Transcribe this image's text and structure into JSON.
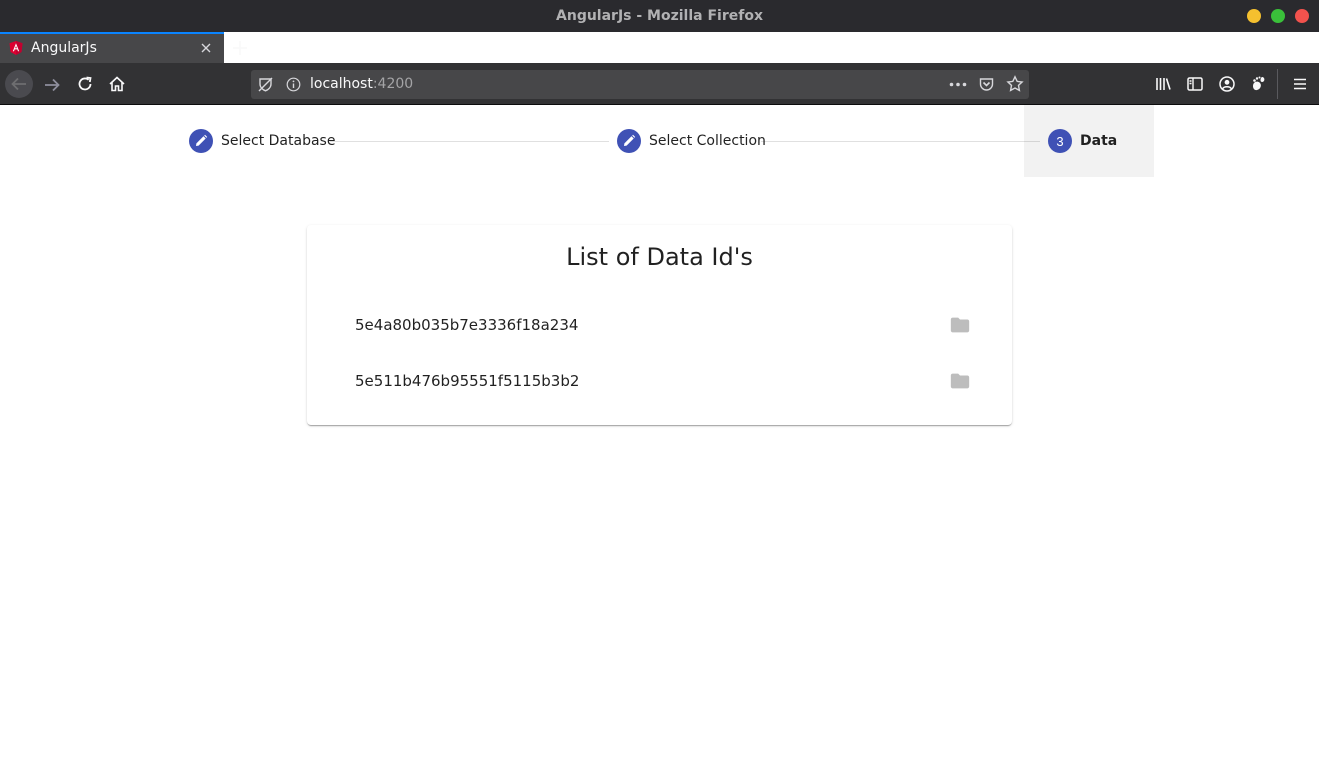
{
  "window": {
    "title": "AngularJs - Mozilla Firefox"
  },
  "tab": {
    "title": "AngularJs",
    "favicon_icon": "angular-icon"
  },
  "urlbar": {
    "host": "localhost",
    "port": ":4200"
  },
  "stepper": {
    "steps": [
      {
        "label": "Select Database",
        "marker": "edit-icon"
      },
      {
        "label": "Select Collection",
        "marker": "edit-icon"
      },
      {
        "label": "Data",
        "number": "3"
      }
    ]
  },
  "card": {
    "title": "List of Data Id's",
    "items": [
      {
        "id": "5e4a80b035b7e3336f18a234",
        "icon": "folder-icon"
      },
      {
        "id": "5e511b476b95551f5115b3b2",
        "icon": "folder-icon"
      }
    ]
  },
  "colors": {
    "primary": "#3f51b5",
    "titlebar": "#2a2a2e",
    "tab_active_accent": "#0a84ff"
  }
}
